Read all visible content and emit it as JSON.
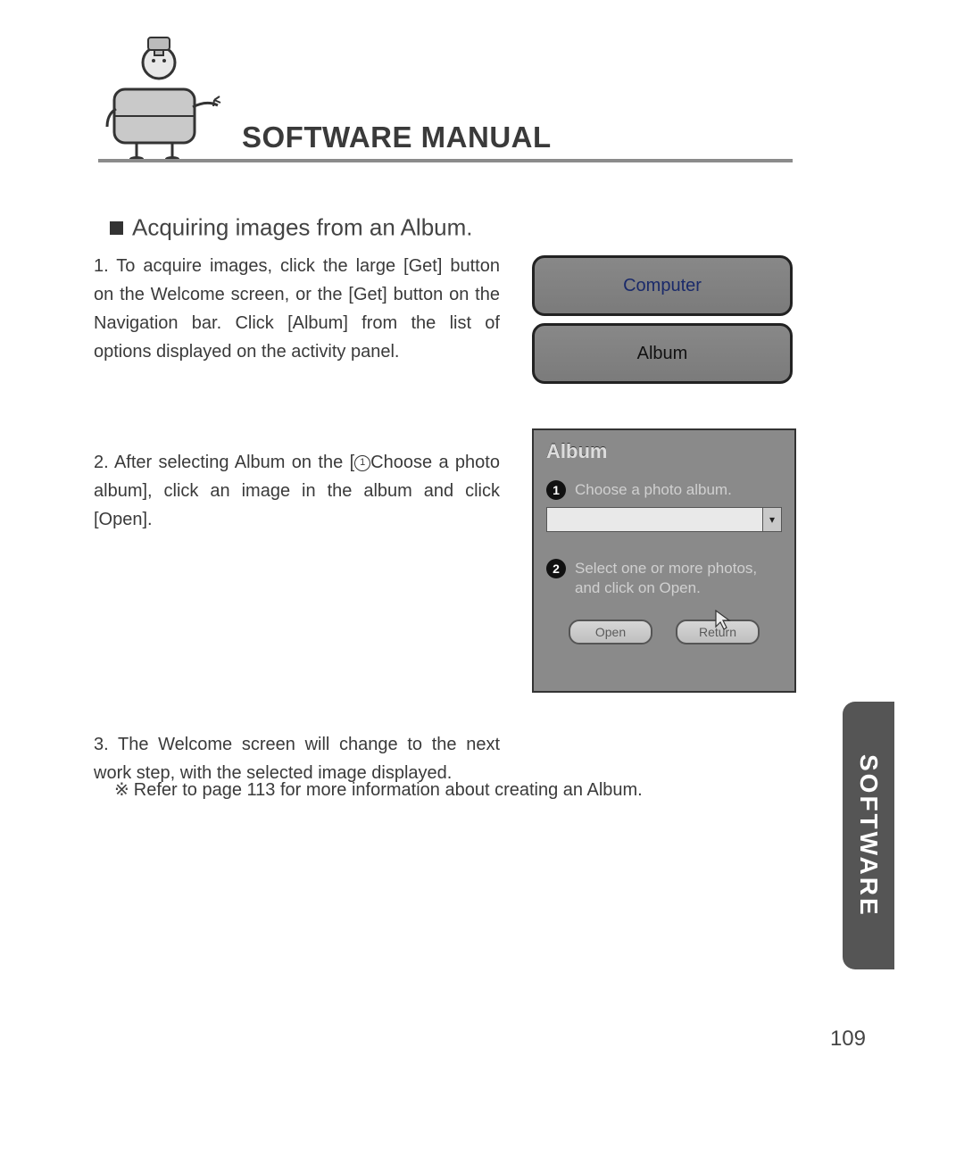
{
  "header": {
    "title": "SOFTWARE MANUAL"
  },
  "section": {
    "heading": "Acquiring images from an Album."
  },
  "steps": {
    "s1_num": "1.",
    "s1": " To acquire images, click the large [Get] button on the Welcome screen, or the [Get] button on the Navigation bar. Click [Album] from the list of options displayed on the activity panel.",
    "s2_num": "2.",
    "s2a": " After selecting Album on the [",
    "s2_circle": "1",
    "s2b": "Choose a photo album], click an image in the album and click [Open].",
    "s3_num": "3.",
    "s3": " The Welcome screen will change to the next work step, with the selected image displayed."
  },
  "note": {
    "symbol": "※",
    "text": "Refer to page 113 for more information about creating an Album."
  },
  "fig1": {
    "top_label": "Computer",
    "bottom_label": "Album"
  },
  "fig2": {
    "title": "Album",
    "badge1": "1",
    "step1_text": "Choose a photo album.",
    "dropdown_value": "",
    "dropdown_arrow": "▾",
    "badge2": "2",
    "step2_text": "Select one or more photos, and click on Open.",
    "btn_open": "Open",
    "btn_return": "Return"
  },
  "sidetab": {
    "label": "SOFTWARE"
  },
  "page_number": "109"
}
